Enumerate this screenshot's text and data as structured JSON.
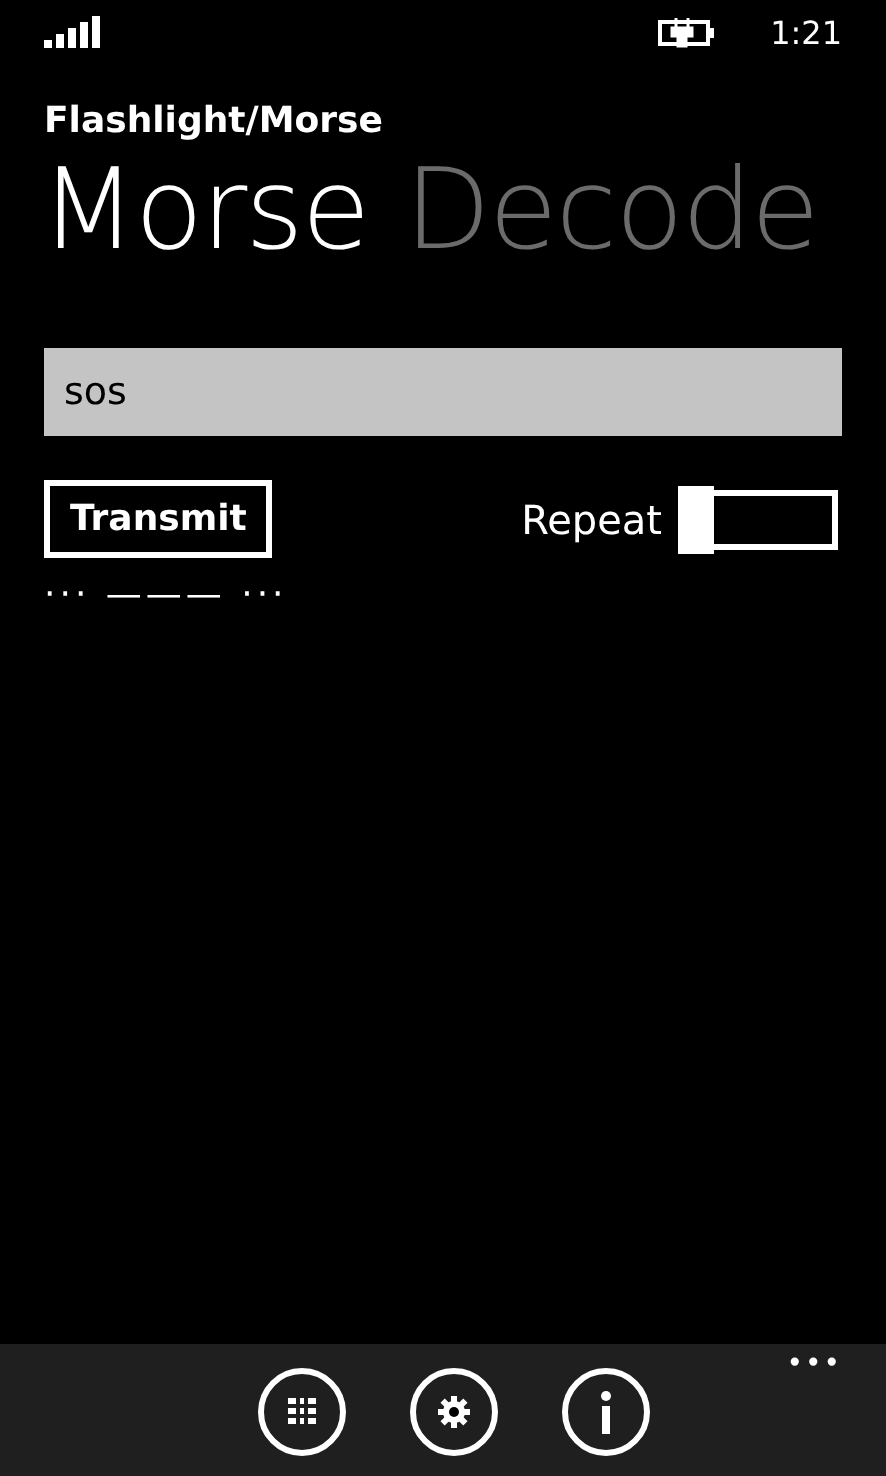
{
  "status_bar": {
    "time": "1:21"
  },
  "app_title": "Flashlight/Morse",
  "pivots": [
    {
      "label": "Morse",
      "selected": true
    },
    {
      "label": "Decode",
      "selected": false
    }
  ],
  "message_field": {
    "value": "sos"
  },
  "transmit_button": "Transmit",
  "repeat": {
    "label": "Repeat",
    "on": false
  },
  "morse_output": "··· ——— ···",
  "app_bar": {
    "buttons": [
      {
        "kind": "grid"
      },
      {
        "kind": "settings"
      },
      {
        "kind": "info"
      }
    ],
    "more": "•••"
  }
}
